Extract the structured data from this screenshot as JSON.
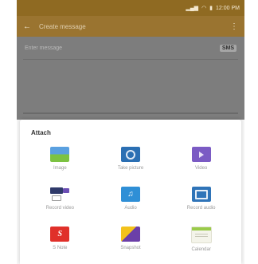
{
  "status_bar": {
    "icons": [
      "signal-icon",
      "wifi-icon",
      "battery-icon"
    ],
    "time": "12:00 PM"
  },
  "toolbar": {
    "title": "Create message",
    "back_icon": "arrow-back-icon",
    "menu_icon": "more-vert-icon"
  },
  "compose": {
    "subject_placeholder": "Enter message",
    "sms_badge": "SMS"
  },
  "sheet": {
    "title": "Attach",
    "items": [
      {
        "label": "Image",
        "icon": "image-icon"
      },
      {
        "label": "Take picture",
        "icon": "camera-icon"
      },
      {
        "label": "Video",
        "icon": "video-icon"
      },
      {
        "label": "Record video",
        "icon": "record-video-icon"
      },
      {
        "label": "Audio",
        "icon": "audio-icon"
      },
      {
        "label": "Record audio",
        "icon": "record-audio-icon"
      },
      {
        "label": "S Note",
        "icon": "s-note-icon"
      },
      {
        "label": "Snapshot",
        "icon": "snapshot-icon"
      },
      {
        "label": "Calendar",
        "icon": "calendar-icon"
      }
    ]
  },
  "colors": {
    "status_bar": "#8f6a22",
    "toolbar": "#9a7430",
    "overlay": "#7d7d7d",
    "sheet": "#ffffff"
  }
}
